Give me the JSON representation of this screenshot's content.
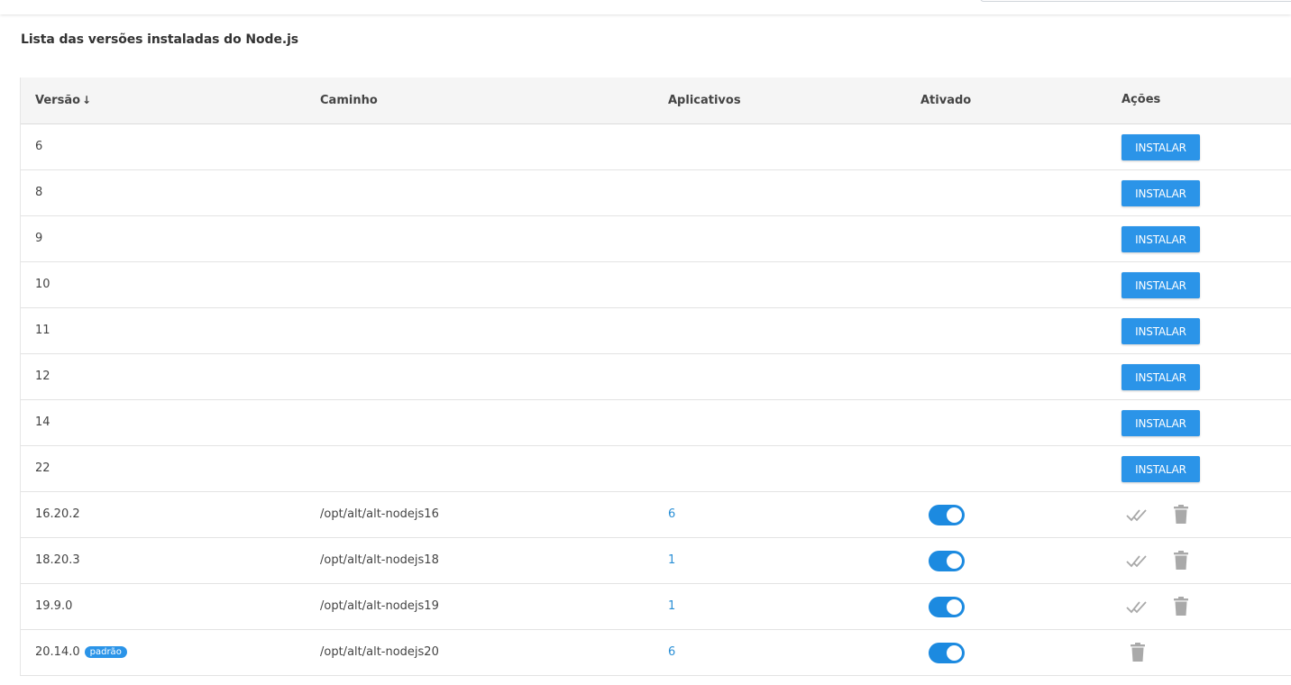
{
  "title": "Lista das versões instaladas do Node.js",
  "columns": {
    "version": "Versão",
    "sort_icon": "arrow-down-icon",
    "path": "Caminho",
    "apps": "Aplicativos",
    "active": "Ativado",
    "actions": "Ações"
  },
  "install_label": "INSTALAR",
  "available": [
    {
      "version": "6"
    },
    {
      "version": "8"
    },
    {
      "version": "9"
    },
    {
      "version": "10"
    },
    {
      "version": "11"
    },
    {
      "version": "12"
    },
    {
      "version": "14"
    },
    {
      "version": "22"
    }
  ],
  "installed": [
    {
      "version": "16.20.2",
      "path": "/opt/alt/alt-nodejs16",
      "apps": "6",
      "active": true,
      "can_set_default": true
    },
    {
      "version": "18.20.3",
      "path": "/opt/alt/alt-nodejs18",
      "apps": "1",
      "active": true,
      "can_set_default": true
    },
    {
      "version": "19.9.0",
      "path": "/opt/alt/alt-nodejs19",
      "apps": "1",
      "active": true,
      "can_set_default": true
    },
    {
      "version": "20.14.0",
      "badge": "padrão",
      "path": "/opt/alt/alt-nodejs20",
      "apps": "6",
      "active": true,
      "can_set_default": false
    }
  ],
  "colors": {
    "primary": "#2b94e8",
    "toggle_on": "#1c8ae0",
    "link": "#2a8fd6",
    "icon_muted": "#a9a9a9"
  }
}
